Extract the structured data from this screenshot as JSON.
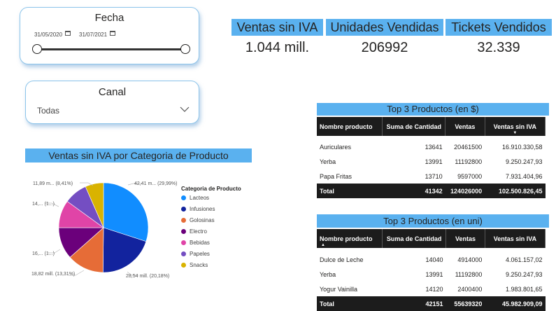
{
  "fecha_slicer": {
    "title": "Fecha",
    "start": "31/05/2020",
    "end": "31/07/2021",
    "calendar_icon": "calendar-icon"
  },
  "canal_slicer": {
    "title": "Canal",
    "selected": "Todas",
    "chevron_icon": "chevron-down-icon"
  },
  "kpis": [
    {
      "label": "Ventas sin IVA",
      "value": "1.044 mill."
    },
    {
      "label": "Unidades Vendidas",
      "value": "206992"
    },
    {
      "label": "Tickets Vendidos",
      "value": "32.339"
    }
  ],
  "pie": {
    "title": "Ventas sin IVA por Categoria de Producto",
    "legend_title": "Categoria de Producto",
    "labels": {
      "lacteos": "42,41 m... (29,99%)",
      "infusiones": "28,54 mill. (20,18%)",
      "golosinas": "18,82 mill. (13,31%)",
      "electro": "16,... (1...)",
      "bebidas": "14,... (1...)",
      "papeles": "11,89 m... (8,41%)"
    }
  },
  "chart_data": {
    "type": "pie",
    "title": "Ventas sin IVA por Categoria de Producto",
    "legend_title": "Categoria de Producto",
    "categories": [
      "Lacteos",
      "Infusiones",
      "Golosinas",
      "Electro",
      "Bebidas",
      "Papeles",
      "Snacks"
    ],
    "values": [
      29.99,
      20.18,
      13.31,
      11.5,
      10.0,
      8.41,
      6.61
    ],
    "colors": [
      "#118dff",
      "#12239e",
      "#e66c37",
      "#6b007b",
      "#e044a7",
      "#744ec2",
      "#d9b300"
    ],
    "legend_position": "right"
  },
  "table1": {
    "title": "Top 3 Productos (en $)",
    "headers": [
      "Nombre producto",
      "Suma de Cantidad",
      "Ventas",
      "Ventas sin IVA"
    ],
    "rows": [
      [
        "Auriculares",
        "13641",
        "20461500",
        "16.910.330,58"
      ],
      [
        "Yerba",
        "13991",
        "11192800",
        "9.250.247,93"
      ],
      [
        "Papa Fritas",
        "13710",
        "9597000",
        "7.931.404,96"
      ]
    ],
    "total": [
      "Total",
      "41342",
      "124026000",
      "102.500.826,45"
    ]
  },
  "table2": {
    "title": "Top 3 Productos (en uni)",
    "headers": [
      "Nombre producto",
      "Suma de Cantidad",
      "Ventas",
      "Ventas sin IVA"
    ],
    "rows": [
      [
        "Dulce de Leche",
        "14040",
        "4914000",
        "4.061.157,02"
      ],
      [
        "Yerba",
        "13991",
        "11192800",
        "9.250.247,93"
      ],
      [
        "Yogur Vainilla",
        "14120",
        "2400400",
        "1.983.801,65"
      ]
    ],
    "total": [
      "Total",
      "42151",
      "55639320",
      "45.982.909,09"
    ]
  }
}
